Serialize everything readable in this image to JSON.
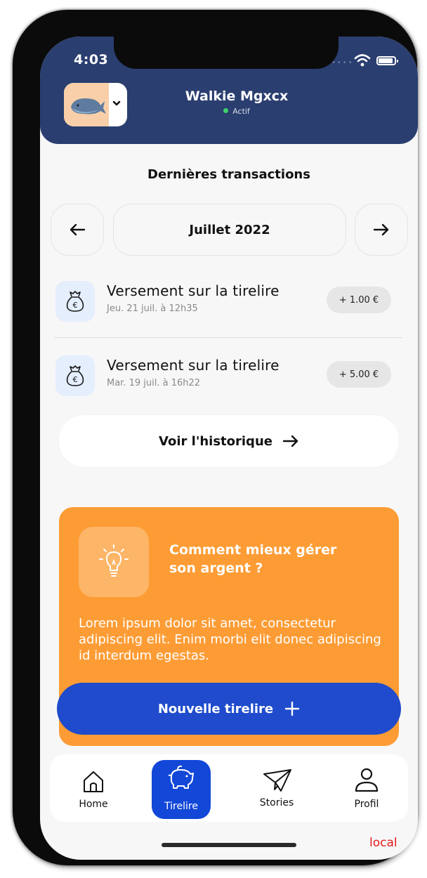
{
  "status_bar": {
    "time": "4:03"
  },
  "header": {
    "user_name": "Walkie Mgxcx",
    "user_status": "Actif"
  },
  "transactions": {
    "title": "Dernières transactions",
    "month": "Juillet 2022",
    "items": [
      {
        "title": "Versement sur la tirelire",
        "date": "Jeu. 21 juil. à 12h35",
        "amount": "+ 1.00 €"
      },
      {
        "title": "Versement sur la tirelire",
        "date": "Mar. 19 juil. à 16h22",
        "amount": "+ 5.00 €"
      }
    ],
    "history_label": "Voir l'historique"
  },
  "tip": {
    "title": "Comment mieux gérer son argent ?",
    "text": "Lorem ipsum dolor sit amet, consectetur adipiscing elit. Enim morbi elit donec adipiscing id interdum egestas."
  },
  "new_piggy_label": "Nouvelle tirelire",
  "tabs": [
    {
      "label": "Home",
      "icon": "house-icon",
      "active": false
    },
    {
      "label": "Tirelire",
      "icon": "piggy-bank-icon",
      "active": true
    },
    {
      "label": "Stories",
      "icon": "paper-plane-icon",
      "active": false
    },
    {
      "label": "Profil",
      "icon": "user-icon",
      "active": false
    }
  ],
  "env_label": "local",
  "colors": {
    "header": "#2a3e6f",
    "accent_blue": "#1f4bcc",
    "tip_orange": "#fd9c35",
    "status_green": "#3fd16b",
    "env_red": "#e31b1b"
  }
}
